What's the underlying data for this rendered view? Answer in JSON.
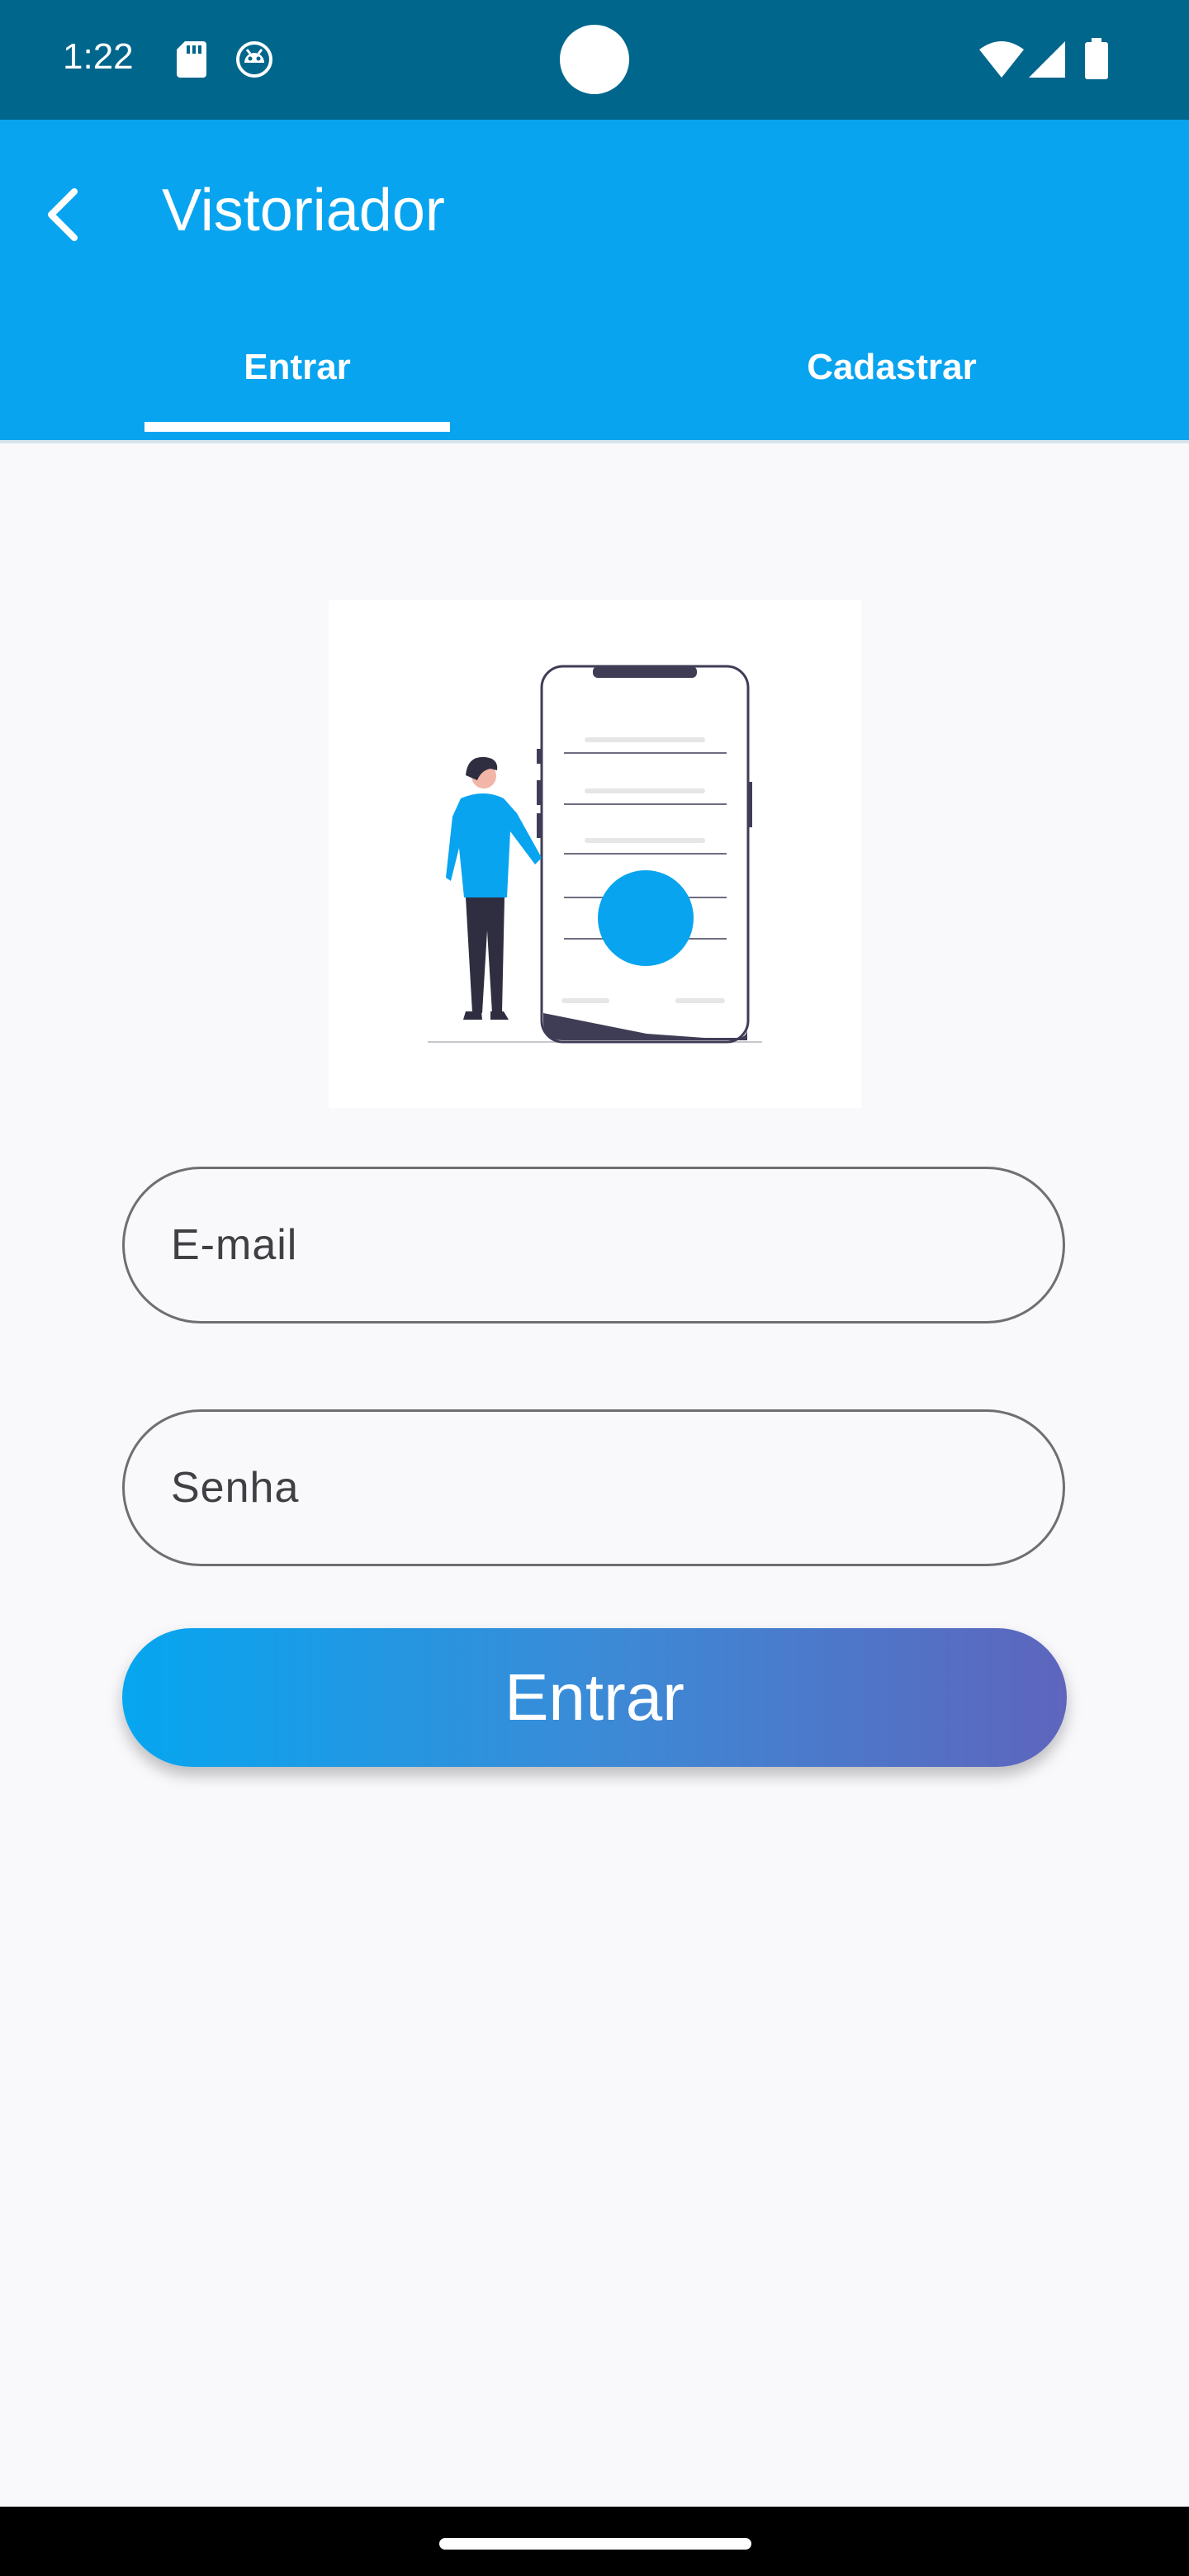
{
  "status_bar": {
    "time": "1:22",
    "icons": [
      "sd-card-icon",
      "android-debug-icon",
      "wifi-icon",
      "signal-icon",
      "battery-icon"
    ]
  },
  "app_bar": {
    "back_icon": "arrow-back-icon",
    "title": "Vistoriador"
  },
  "tabs": [
    {
      "label": "Entrar",
      "selected": true
    },
    {
      "label": "Cadastrar",
      "selected": false
    }
  ],
  "form": {
    "email_placeholder": "E-mail",
    "password_placeholder": "Senha",
    "submit_label": "Entrar"
  },
  "colors": {
    "status_bar": "#00668c",
    "app_bar": "#08a4ef",
    "accent": "#08a4ef",
    "button_gradient_start": "#06a6f0",
    "button_gradient_end": "#5e65bd",
    "background": "#f9f9fc"
  }
}
